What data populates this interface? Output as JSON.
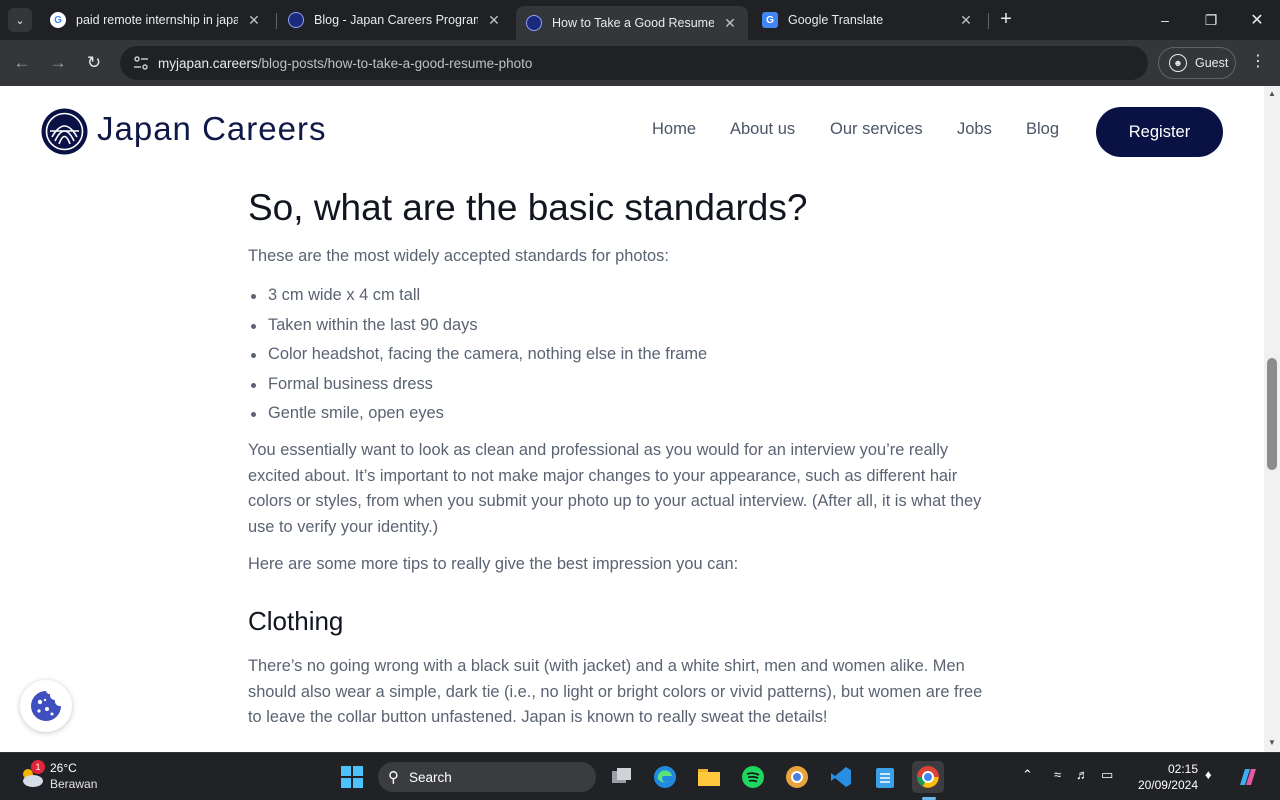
{
  "browser": {
    "tabs": [
      {
        "title": "paid remote internship in japan",
        "favicon": "google-icon"
      },
      {
        "title": "Blog - Japan Careers Program",
        "favicon": "japan-careers-icon"
      },
      {
        "title": "How to Take a Good Resume Photo",
        "favicon": "japan-careers-icon",
        "active": true
      },
      {
        "title": "Google Translate",
        "favicon": "google-translate-icon"
      }
    ],
    "url_host": "myjapan.careers",
    "url_path": "/blog-posts/how-to-take-a-good-resume-photo",
    "profile_label": "Guest"
  },
  "site": {
    "brand": "Japan Careers",
    "nav": [
      "Home",
      "About us",
      "Our services",
      "Jobs",
      "Blog"
    ],
    "register_label": "Register",
    "brand_color": "#0a1245"
  },
  "article": {
    "heading": "So, what are the basic standards?",
    "intro": "These are the most widely accepted standards for photos:",
    "standards": [
      "3 cm wide x 4 cm tall",
      "Taken within the last 90 days",
      "Color headshot, facing the camera, nothing else in the frame",
      "Formal business dress",
      "Gentle smile, open eyes"
    ],
    "para1_lines": [
      "You essentially want to look as clean and professional as you would for an interview you’re really",
      "excited about. It’s important to not make major changes to your appearance, such as different hair",
      "colors or styles, from when you submit your photo up to your actual interview. (After all, it is what they",
      "use to verify your identity.)"
    ],
    "para2": "Here are some more tips to really give the best impression you can:",
    "subheading": "Clothing",
    "para3_lines": [
      "There’s no going wrong with a black suit (with jacket) and a white shirt, men and women alike. Men",
      "should also wear a simple, dark tie (i.e., no light or bright colors or vivid patterns), but women are free",
      "to leave the collar button unfastened. Japan is known to really sweat the details!"
    ]
  },
  "taskbar": {
    "weather_temp": "26°C",
    "weather_desc": "Berawan",
    "weather_badge": "1",
    "search_label": "Search",
    "time": "02:15",
    "date": "20/09/2024"
  }
}
